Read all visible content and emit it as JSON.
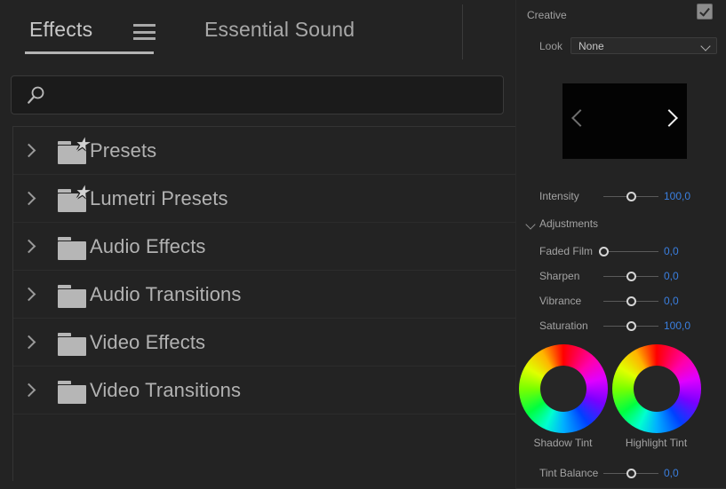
{
  "left_panel": {
    "tabs": [
      {
        "label": "Effects",
        "active": true,
        "icon": "hamburger-icon"
      },
      {
        "label": "Essential Sound",
        "active": false
      }
    ],
    "search": {
      "value": "",
      "placeholder": "",
      "icon": "search-icon"
    },
    "tree_items": [
      {
        "label": "Presets",
        "icon": "folder-star-icon",
        "expanded": false,
        "twisty": "chevron-right-icon"
      },
      {
        "label": "Lumetri Presets",
        "icon": "folder-star-icon",
        "expanded": false,
        "twisty": "chevron-right-icon"
      },
      {
        "label": "Audio Effects",
        "icon": "folder-icon",
        "expanded": false,
        "twisty": "chevron-right-icon"
      },
      {
        "label": "Audio Transitions",
        "icon": "folder-icon",
        "expanded": false,
        "twisty": "chevron-right-icon"
      },
      {
        "label": "Video Effects",
        "icon": "folder-icon",
        "expanded": false,
        "twisty": "chevron-right-icon"
      },
      {
        "label": "Video Transitions",
        "icon": "folder-icon",
        "expanded": false,
        "twisty": "chevron-right-icon"
      }
    ]
  },
  "right_panel": {
    "section": {
      "title": "Creative",
      "enabled": true,
      "checkbox_icon": "checkbox-checked-icon"
    },
    "look": {
      "label": "Look",
      "value": "None",
      "chevron_icon": "chevron-down-icon"
    },
    "preview": {
      "prev_icon": "chevron-left-icon",
      "next_icon": "chevron-right-icon",
      "background": "#030303"
    },
    "intensity": {
      "label": "Intensity",
      "value": "100,0",
      "knob_pct": 50
    },
    "adjustments_header": {
      "label": "Adjustments",
      "expanded": true,
      "chevron_icon": "chevron-down-icon"
    },
    "adjustments": [
      {
        "label": "Faded Film",
        "value": "0,0",
        "knob_pct": 0
      },
      {
        "label": "Sharpen",
        "value": "0,0",
        "knob_pct": 50
      },
      {
        "label": "Vibrance",
        "value": "0,0",
        "knob_pct": 50
      },
      {
        "label": "Saturation",
        "value": "100,0",
        "knob_pct": 50
      }
    ],
    "wheels": [
      {
        "label": "Shadow Tint"
      },
      {
        "label": "Highlight Tint"
      }
    ],
    "tint_balance": {
      "label": "Tint Balance",
      "value": "0,0",
      "knob_pct": 50
    },
    "colors": {
      "value_blue": "#3a7fe0",
      "panel_bg": "#232323",
      "text": "#a3a3a3",
      "accent_underline": "#b4b4b4"
    }
  }
}
